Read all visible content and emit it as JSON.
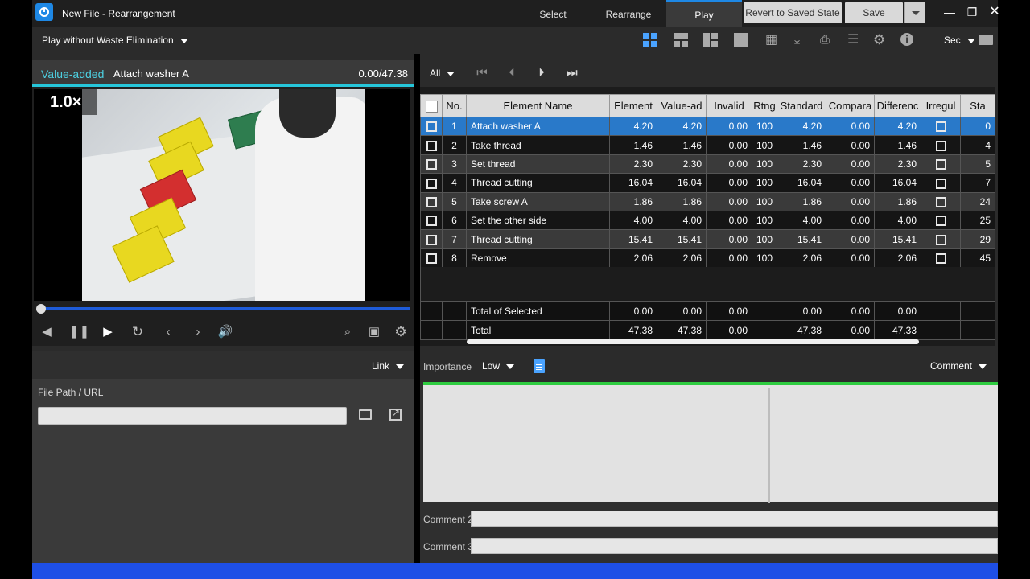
{
  "window": {
    "title": "New File - Rearrangement",
    "modes": [
      "Select",
      "Rearrange",
      "Play"
    ],
    "active_mode": "Play",
    "revert_label": "Revert to Saved State",
    "save_label": "Save"
  },
  "toolbar": {
    "play_mode": "Play without Waste Elimination",
    "time_unit": "Sec",
    "icons": [
      "layout-4-icon",
      "layout-3-icon",
      "layout-2-icon",
      "layout-1-icon",
      "clapper-icon",
      "download-icon",
      "print-icon",
      "list-icon",
      "gear-icon",
      "info-icon",
      "folder-icon"
    ]
  },
  "video": {
    "category": "Value-added",
    "element_name": "Attach washer A",
    "time": "0.00/47.38",
    "speed": "1.0×"
  },
  "link": {
    "label": "Link",
    "file_path_label": "File Path / URL",
    "file_path_value": ""
  },
  "grid": {
    "filter": "All",
    "columns": [
      "No.",
      "Element Name",
      "Element",
      "Value-ad",
      "Invalid",
      "Rtng",
      "Standard",
      "Compara",
      "Differenc",
      "Irregul",
      "Sta"
    ],
    "rows": [
      {
        "no": "1",
        "name": "Attach washer A",
        "element": "4.20",
        "value": "4.20",
        "invalid": "0.00",
        "rtng": "100",
        "standard": "4.20",
        "compare": "0.00",
        "diff": "4.20",
        "start": "0"
      },
      {
        "no": "2",
        "name": "Take thread",
        "element": "1.46",
        "value": "1.46",
        "invalid": "0.00",
        "rtng": "100",
        "standard": "1.46",
        "compare": "0.00",
        "diff": "1.46",
        "start": "4"
      },
      {
        "no": "3",
        "name": "Set thread",
        "element": "2.30",
        "value": "2.30",
        "invalid": "0.00",
        "rtng": "100",
        "standard": "2.30",
        "compare": "0.00",
        "diff": "2.30",
        "start": "5"
      },
      {
        "no": "4",
        "name": "Thread cutting",
        "element": "16.04",
        "value": "16.04",
        "invalid": "0.00",
        "rtng": "100",
        "standard": "16.04",
        "compare": "0.00",
        "diff": "16.04",
        "start": "7"
      },
      {
        "no": "5",
        "name": "Take screw A",
        "element": "1.86",
        "value": "1.86",
        "invalid": "0.00",
        "rtng": "100",
        "standard": "1.86",
        "compare": "0.00",
        "diff": "1.86",
        "start": "24"
      },
      {
        "no": "6",
        "name": "Set the other side",
        "element": "4.00",
        "value": "4.00",
        "invalid": "0.00",
        "rtng": "100",
        "standard": "4.00",
        "compare": "0.00",
        "diff": "4.00",
        "start": "25"
      },
      {
        "no": "7",
        "name": "Thread cutting",
        "element": "15.41",
        "value": "15.41",
        "invalid": "0.00",
        "rtng": "100",
        "standard": "15.41",
        "compare": "0.00",
        "diff": "15.41",
        "start": "29"
      },
      {
        "no": "8",
        "name": "Remove",
        "element": "2.06",
        "value": "2.06",
        "invalid": "0.00",
        "rtng": "100",
        "standard": "2.06",
        "compare": "0.00",
        "diff": "2.06",
        "start": "45"
      }
    ],
    "totals": [
      {
        "label": "Total of Selected",
        "element": "0.00",
        "value": "0.00",
        "invalid": "0.00",
        "standard": "0.00",
        "compare": "0.00",
        "diff": "0.00"
      },
      {
        "label": "Total",
        "element": "47.38",
        "value": "47.38",
        "invalid": "0.00",
        "standard": "47.38",
        "compare": "0.00",
        "diff": "47.33"
      }
    ]
  },
  "comment": {
    "importance_label": "Importance",
    "importance_value": "Low",
    "comment_label": "Comment",
    "comment2_label": "Comment 2",
    "comment3_label": "Comment 3"
  },
  "colors": {
    "accent": "#1e88e5",
    "selected_row": "#2979c9",
    "category_text": "#4dd0e1",
    "status_bar": "#1e4fe6",
    "comment_border": "#2ecc40"
  }
}
